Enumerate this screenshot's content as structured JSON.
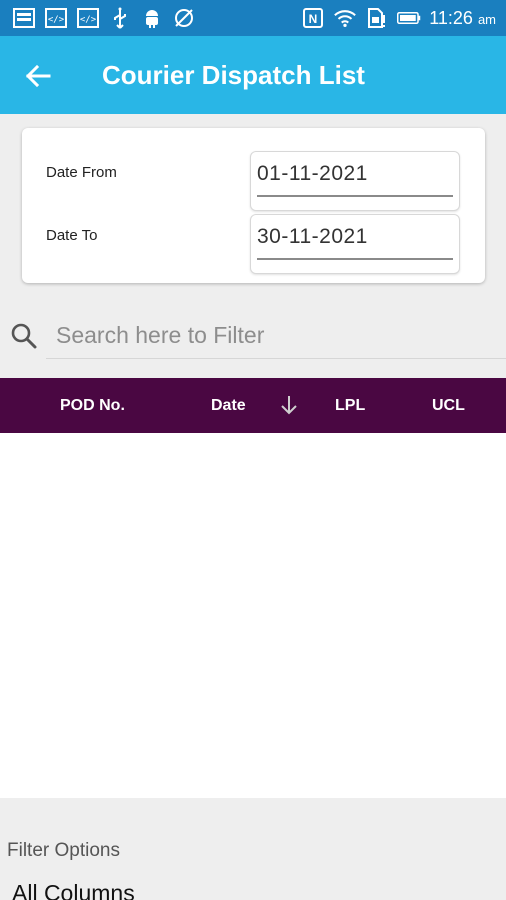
{
  "status_bar": {
    "time": "11:26",
    "ampm": "am",
    "left_icons": [
      "image-icon",
      "code-icon",
      "code-icon",
      "usb-icon",
      "android-debug-icon",
      "no-sync-icon"
    ],
    "right_icons": [
      "nfc-icon",
      "wifi-icon",
      "sim-icon",
      "battery-icon"
    ]
  },
  "app_bar": {
    "title": "Courier Dispatch List",
    "back_icon": "arrow-back-icon",
    "color": "#29b6e6"
  },
  "date_filter": {
    "from_label": "Date From",
    "from_value": "01-11-2021",
    "to_label": "Date To",
    "to_value": "30-11-2021"
  },
  "search": {
    "placeholder": "Search here to Filter",
    "icon": "search-icon"
  },
  "table": {
    "header_color": "#4a0742",
    "columns": [
      {
        "label": "POD No."
      },
      {
        "label": "Date",
        "sort": "descending"
      },
      {
        "label": "LPL"
      },
      {
        "label": "UCL"
      }
    ],
    "rows": []
  },
  "filter_options": {
    "title": "Filter Options",
    "selected": "All Columns"
  }
}
